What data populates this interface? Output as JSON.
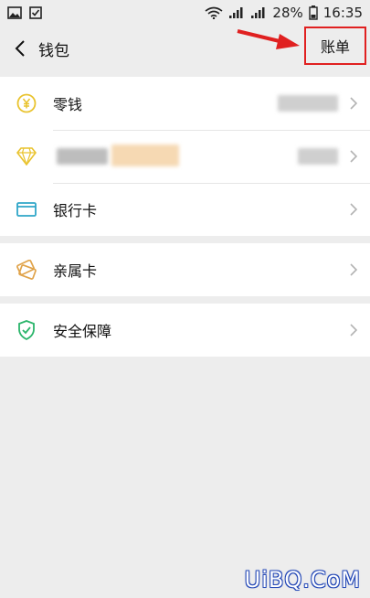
{
  "status_bar": {
    "battery": "28%",
    "time": "16:35"
  },
  "nav": {
    "title": "钱包",
    "bill_button": "账单"
  },
  "colors": {
    "highlight": "#e02020",
    "change_icon": "#e9c32e",
    "diamond_icon": "#e9c32e",
    "card_icon": "#2fa6c8",
    "family_icon": "#e0a34a",
    "shield_icon": "#2bb56b"
  },
  "groups": [
    {
      "items": [
        {
          "label": "零钱",
          "icon": "yen-coin-icon"
        },
        {
          "label": "",
          "icon": "diamond-icon"
        },
        {
          "label": "银行卡",
          "icon": "bank-card-icon"
        }
      ]
    },
    {
      "items": [
        {
          "label": "亲属卡",
          "icon": "family-card-icon"
        }
      ]
    },
    {
      "items": [
        {
          "label": "安全保障",
          "icon": "shield-check-icon"
        }
      ]
    }
  ],
  "watermark": "UiBQ.CoM"
}
